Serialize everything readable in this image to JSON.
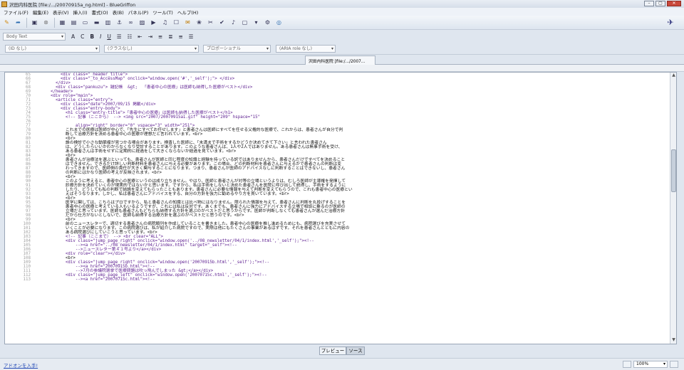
{
  "window": {
    "title": "沢田内科医院 [file:/.../20070915a_ng.html] - BlueGriffon"
  },
  "menubar": [
    "ファイル(F)",
    "編集(E)",
    "表示(V)",
    "挿入(I)",
    "書式(O)",
    "表(B)",
    "パネル(P)",
    "ツール(T)",
    "ヘルプ(H)"
  ],
  "toolbar2": {
    "format_select": "Body Text",
    "bold": "B",
    "italic": "I",
    "underline": "U",
    "clear_format": "C"
  },
  "toolbar3": {
    "id_select": "(ID なし)",
    "class_select": "(クラスなし)",
    "proportional_select": "プロポーショナル",
    "aria_select": "(ARIA role なし)"
  },
  "document_tab": "沢田内科医院 [file:/.../2007...",
  "code": [
    {
      "n": "65",
      "t": "        <div class=\"_header_title\">",
      "tag": true
    },
    {
      "n": "66",
      "t": "        <div class=\"_to_AccessMap\" onclick=\"window.open('#','_self');\"> </div>",
      "tag": true
    },
    {
      "n": "67",
      "t": "      </div>",
      "tag": true
    },
    {
      "n": "68",
      "t": "      <div class=\"pankuzu\"> 雑記帳  &gt;  「患者中心の医療」は医師も納得した医療がベスト</div>",
      "tag": true
    },
    {
      "n": "69",
      "t": "    </header>",
      "tag": true
    },
    {
      "n": "70",
      "t": "    <div role=\"main\">",
      "tag": true
    },
    {
      "n": "71",
      "t": "      <article class=\"entry\">",
      "tag": true
    },
    {
      "n": "72",
      "t": "        <div class=\"date\">2007/09/15 掲載</div>",
      "tag": true
    },
    {
      "n": "73",
      "t": "        <div class=\"entry-body\">",
      "tag": true
    },
    {
      "n": "74",
      "t": "          <h1 class=\"entry-title\">「患者中心の医療」は医師も納得した医療がベスト</h1>",
      "tag": true
    },
    {
      "n": "75",
      "t": "          <!-- 記事（ここから） --> <img src=\"2007/20070915a1.gif\" height=\"209\" hspace=\"15\"",
      "tag": true
    },
    {
      "n": "76",
      "t": "",
      "tag": false
    },
    {
      "n": "77",
      "t": "              align=\"right\" border=\"0\" vspace=\"3\" width=\"251\">",
      "tag": true
    },
    {
      "n": "78",
      "t": "          これまでの医療は医師が中心で、「先生にすべてお任せします」と患者さんは医師にすべてを任せる父権的な医療で、これからは、患者さんが自分で判",
      "tag": false
    },
    {
      "n": "79",
      "t": "          断して治療方針を決める患者中心の医療が理想だと言われています。<br>",
      "tag": false
    },
    {
      "n": "80",
      "t": "          <br>",
      "tag": false
    },
    {
      "n": "81",
      "t": "          誰の検診で小さな動脈瘤が見つかる場合があります。検査した医師に、「未満まで手術をするかどうか決めてきて下さい」と言われた患者さん",
      "tag": false
    },
    {
      "n": "82",
      "t": "          は、どうしたらいいかわからなくなり受診することがあります。このような患者さんは、1人や2人ではありません。ある患者さんは無事手術を受け、",
      "tag": false
    },
    {
      "n": "83",
      "t": "          ある患者さんは手術をせずに定期的に経過をして大きくならないか経過を見ています。<br>",
      "tag": false
    },
    {
      "n": "84",
      "t": "          <br>",
      "tag": false
    },
    {
      "n": "85",
      "t": "          患者さんが治療法を選ぶといっても、患者さんが医師と同じ程度の知識と経験を持っている訳ではありませんから、患者さんだけですべてを決めること",
      "tag": false
    },
    {
      "n": "86",
      "t": "          はできません。できるだけ詳しい判断材料を患者さんに与える必要があります。この場合、どの判断材料を患者さんに与えるかで患者さんの判断は変",
      "tag": false
    },
    {
      "n": "87",
      "t": "          わってきますので、医師側の責任が大きく関与することになります。つまり、患者さんが医師のアドバイスなしに判断することはできないし、患者さん",
      "tag": false
    },
    {
      "n": "88",
      "t": "          の判断にはかなり医師の考えが反映されます。<br>",
      "tag": false
    },
    {
      "n": "89",
      "t": "          <br>",
      "tag": false
    },
    {
      "n": "90",
      "t": "          このように考えると、患者中心の医療というのは成り立ちません。やはり、医師と患者さんが対等の立場というよりは、むしろ医師が主導権を発揮して",
      "tag": false
    },
    {
      "n": "91",
      "t": "          診療方針を決めていくのが現実的ではないかと思います。ですから、私は手術をしないと決めた患者さんを医院に呼び出して説得し、手術をするように",
      "tag": false
    },
    {
      "n": "92",
      "t": "          したり、どうしても私の判断で結論を変えてもらったこともあります。患者さんに必要な情報を与えて判断を変えてもらうので、これも患者中心の医療とい",
      "tag": false
    },
    {
      "n": "93",
      "t": "          えばそうなります。しかし、私は患者さんにアドバイスをする、自分の方針を強力に勧めるやり方を貫いています。<br>",
      "tag": false
    },
    {
      "n": "94",
      "t": "          <br>",
      "tag": false
    },
    {
      "n": "95",
      "t": "          医学に関しては、こちらはプロですから、私と患者さんの知識とは比べ物にはなりません。限られた情報を与えて、患者さんに判断を丸投げすることを",
      "tag": false
    },
    {
      "n": "96",
      "t": "          患者中心の医療と考えている人もいるようですが、これには私は反対です。あくまでも、患者さんに強力にアドバイスする立場で相談に乗るのが医師の",
      "tag": false
    },
    {
      "n": "97",
      "t": "          立場だと思っています。医師も患者さんもどちらも納得する方針を選ぶのがベストだと思うからです。医師が判断しなくても患者さんが選んだ治療方針",
      "tag": false
    },
    {
      "n": "98",
      "t": "          だから仕方がないとしないで、医師も納得する治療方針を選ぶのがベストだと思うのです。<br>",
      "tag": false
    },
    {
      "n": "99",
      "t": "          <br>",
      "tag": false
    },
    {
      "n": "100",
      "t": "          前のニュースレターで、適切する患者さんの病院順列を作成していることを書きました。患者中心の医療を推し進めるためにも、病院選びを充実させて",
      "tag": false
    },
    {
      "n": "101",
      "t": "          いくことが必要になります。この病院選びは、私が紹介した病院ですので、実際は他にもたくさんの事業があるはずです。それを患者さんとともに内容の",
      "tag": false
    },
    {
      "n": "102",
      "t": "          ある病院選びにしていこうと思っています。<br>",
      "tag": false
    },
    {
      "n": "103",
      "t": "          <!-- 記事（ここまで） --> <br clear=\"ALL\">",
      "tag": true
    },
    {
      "n": "104",
      "t": "          <div class=\"jump_page_right\" onclick=\"window.open('../08_newsletter/04/1/index.html','_self');\"><!--",
      "tag": true
    },
    {
      "n": "105",
      "t": "              --><a href=\"../08_newsletter/04/1/index.html\" target=\"_self\"><!--",
      "tag": true
    },
    {
      "n": "106",
      "t": "              -->ニュースレター第４１号より</a></div>",
      "tag": true
    },
    {
      "n": "107",
      "t": "          <div role=\"clear\"></div>",
      "tag": true
    },
    {
      "n": "108",
      "t": "          <br>",
      "tag": false
    },
    {
      "n": "109",
      "t": "          <div class=\"jump_page_right\" onclick=\"window.open('20070915b.html','_self');\"><!--",
      "tag": true
    },
    {
      "n": "110",
      "t": "              --><a href=\"20070915b.html\"><!--",
      "tag": true
    },
    {
      "n": "111",
      "t": "              -->7月の参議院選挙で医療問題は吹っ飛んでしまった &gt;</a></div>",
      "tag": true
    },
    {
      "n": "112",
      "t": "          <div class=\"jump_page_left\" onclick=\"window.open('20070715c.html','_self');\"><!--",
      "tag": true
    },
    {
      "n": "113",
      "t": "              --><a href=\"20070715c.html\"><!--",
      "tag": true
    }
  ],
  "mode_tabs": {
    "preview": "プレビュー",
    "source": "ソース"
  },
  "status": {
    "addon_link": "アドオンを入手!",
    "zoom": "100%"
  }
}
